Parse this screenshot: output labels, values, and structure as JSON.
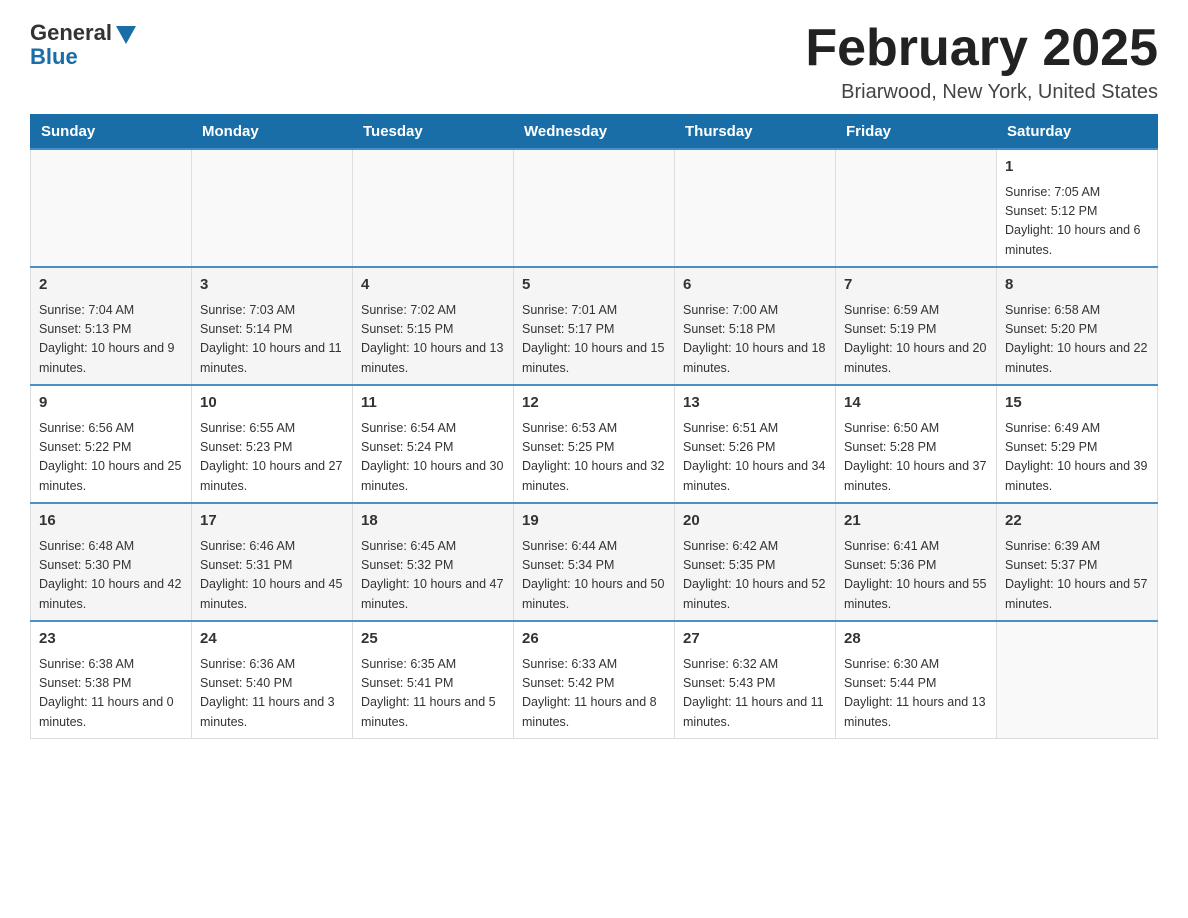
{
  "logo": {
    "general": "General",
    "blue": "Blue"
  },
  "header": {
    "title": "February 2025",
    "subtitle": "Briarwood, New York, United States"
  },
  "weekdays": [
    "Sunday",
    "Monday",
    "Tuesday",
    "Wednesday",
    "Thursday",
    "Friday",
    "Saturday"
  ],
  "weeks": [
    {
      "days": [
        {
          "number": "",
          "info": ""
        },
        {
          "number": "",
          "info": ""
        },
        {
          "number": "",
          "info": ""
        },
        {
          "number": "",
          "info": ""
        },
        {
          "number": "",
          "info": ""
        },
        {
          "number": "",
          "info": ""
        },
        {
          "number": "1",
          "info": "Sunrise: 7:05 AM\nSunset: 5:12 PM\nDaylight: 10 hours and 6 minutes."
        }
      ]
    },
    {
      "days": [
        {
          "number": "2",
          "info": "Sunrise: 7:04 AM\nSunset: 5:13 PM\nDaylight: 10 hours and 9 minutes."
        },
        {
          "number": "3",
          "info": "Sunrise: 7:03 AM\nSunset: 5:14 PM\nDaylight: 10 hours and 11 minutes."
        },
        {
          "number": "4",
          "info": "Sunrise: 7:02 AM\nSunset: 5:15 PM\nDaylight: 10 hours and 13 minutes."
        },
        {
          "number": "5",
          "info": "Sunrise: 7:01 AM\nSunset: 5:17 PM\nDaylight: 10 hours and 15 minutes."
        },
        {
          "number": "6",
          "info": "Sunrise: 7:00 AM\nSunset: 5:18 PM\nDaylight: 10 hours and 18 minutes."
        },
        {
          "number": "7",
          "info": "Sunrise: 6:59 AM\nSunset: 5:19 PM\nDaylight: 10 hours and 20 minutes."
        },
        {
          "number": "8",
          "info": "Sunrise: 6:58 AM\nSunset: 5:20 PM\nDaylight: 10 hours and 22 minutes."
        }
      ]
    },
    {
      "days": [
        {
          "number": "9",
          "info": "Sunrise: 6:56 AM\nSunset: 5:22 PM\nDaylight: 10 hours and 25 minutes."
        },
        {
          "number": "10",
          "info": "Sunrise: 6:55 AM\nSunset: 5:23 PM\nDaylight: 10 hours and 27 minutes."
        },
        {
          "number": "11",
          "info": "Sunrise: 6:54 AM\nSunset: 5:24 PM\nDaylight: 10 hours and 30 minutes."
        },
        {
          "number": "12",
          "info": "Sunrise: 6:53 AM\nSunset: 5:25 PM\nDaylight: 10 hours and 32 minutes."
        },
        {
          "number": "13",
          "info": "Sunrise: 6:51 AM\nSunset: 5:26 PM\nDaylight: 10 hours and 34 minutes."
        },
        {
          "number": "14",
          "info": "Sunrise: 6:50 AM\nSunset: 5:28 PM\nDaylight: 10 hours and 37 minutes."
        },
        {
          "number": "15",
          "info": "Sunrise: 6:49 AM\nSunset: 5:29 PM\nDaylight: 10 hours and 39 minutes."
        }
      ]
    },
    {
      "days": [
        {
          "number": "16",
          "info": "Sunrise: 6:48 AM\nSunset: 5:30 PM\nDaylight: 10 hours and 42 minutes."
        },
        {
          "number": "17",
          "info": "Sunrise: 6:46 AM\nSunset: 5:31 PM\nDaylight: 10 hours and 45 minutes."
        },
        {
          "number": "18",
          "info": "Sunrise: 6:45 AM\nSunset: 5:32 PM\nDaylight: 10 hours and 47 minutes."
        },
        {
          "number": "19",
          "info": "Sunrise: 6:44 AM\nSunset: 5:34 PM\nDaylight: 10 hours and 50 minutes."
        },
        {
          "number": "20",
          "info": "Sunrise: 6:42 AM\nSunset: 5:35 PM\nDaylight: 10 hours and 52 minutes."
        },
        {
          "number": "21",
          "info": "Sunrise: 6:41 AM\nSunset: 5:36 PM\nDaylight: 10 hours and 55 minutes."
        },
        {
          "number": "22",
          "info": "Sunrise: 6:39 AM\nSunset: 5:37 PM\nDaylight: 10 hours and 57 minutes."
        }
      ]
    },
    {
      "days": [
        {
          "number": "23",
          "info": "Sunrise: 6:38 AM\nSunset: 5:38 PM\nDaylight: 11 hours and 0 minutes."
        },
        {
          "number": "24",
          "info": "Sunrise: 6:36 AM\nSunset: 5:40 PM\nDaylight: 11 hours and 3 minutes."
        },
        {
          "number": "25",
          "info": "Sunrise: 6:35 AM\nSunset: 5:41 PM\nDaylight: 11 hours and 5 minutes."
        },
        {
          "number": "26",
          "info": "Sunrise: 6:33 AM\nSunset: 5:42 PM\nDaylight: 11 hours and 8 minutes."
        },
        {
          "number": "27",
          "info": "Sunrise: 6:32 AM\nSunset: 5:43 PM\nDaylight: 11 hours and 11 minutes."
        },
        {
          "number": "28",
          "info": "Sunrise: 6:30 AM\nSunset: 5:44 PM\nDaylight: 11 hours and 13 minutes."
        },
        {
          "number": "",
          "info": ""
        }
      ]
    }
  ]
}
